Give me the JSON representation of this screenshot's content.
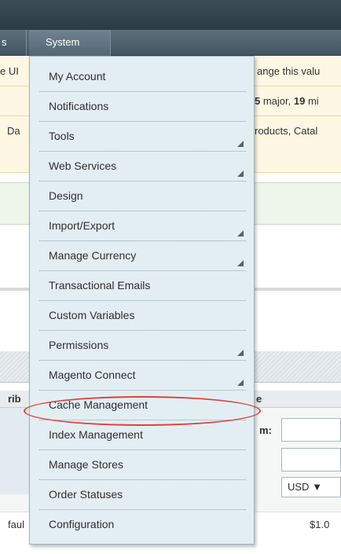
{
  "nav": {
    "prev_tab_label": "s",
    "system_tab_label": "System"
  },
  "notices": {
    "line1_left": "e UI",
    "line1_right": "ange this valu",
    "line2_bold_left": "5",
    "line2_middle": " major, ",
    "line2_bold_right": "19",
    "line2_end": " mi",
    "line3_left": "Da",
    "line3_right": "roducts, Catal"
  },
  "grid": {
    "col_left_fragment": "rib",
    "col_right_fragment": "e",
    "form_label_fragment": "m:",
    "currency_select_value": "USD",
    "row_left_fragment": "faul",
    "row_price_fragment": "$1.0"
  },
  "menu": {
    "items": [
      {
        "label": "My Account",
        "has_submenu": false
      },
      {
        "label": "Notifications",
        "has_submenu": false
      },
      {
        "label": "Tools",
        "has_submenu": true
      },
      {
        "label": "Web Services",
        "has_submenu": true
      },
      {
        "label": "Design",
        "has_submenu": false
      },
      {
        "label": "Import/Export",
        "has_submenu": true
      },
      {
        "label": "Manage Currency",
        "has_submenu": true
      },
      {
        "label": "Transactional Emails",
        "has_submenu": false
      },
      {
        "label": "Custom Variables",
        "has_submenu": false
      },
      {
        "label": "Permissions",
        "has_submenu": true
      },
      {
        "label": "Magento Connect",
        "has_submenu": true
      },
      {
        "label": "Cache Management",
        "has_submenu": false,
        "highlighted": true
      },
      {
        "label": "Index Management",
        "has_submenu": false
      },
      {
        "label": "Manage Stores",
        "has_submenu": false
      },
      {
        "label": "Order Statuses",
        "has_submenu": false
      },
      {
        "label": "Configuration",
        "has_submenu": false
      }
    ]
  },
  "colors": {
    "header_bg": "#2c3b44",
    "menu_bg": "#e3eef3",
    "notice_bg": "#fdf7e3",
    "highlight_circle": "#e0403a"
  }
}
